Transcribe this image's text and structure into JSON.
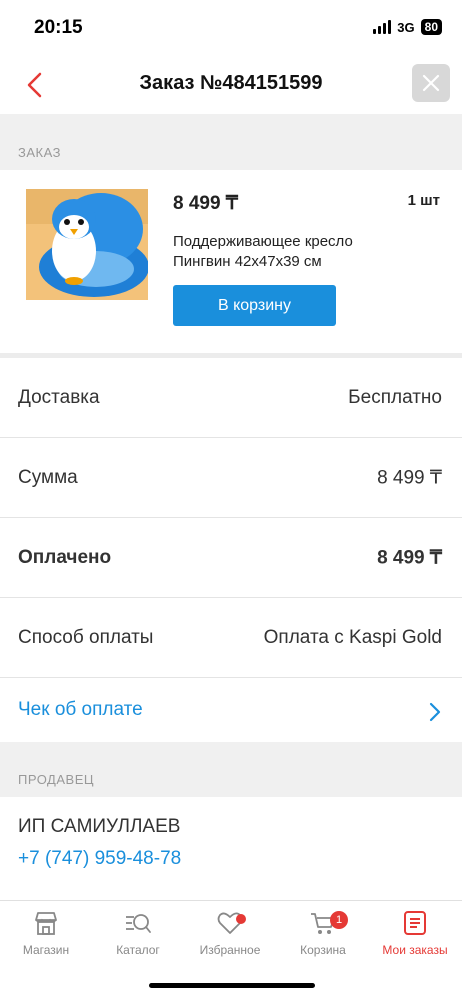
{
  "status": {
    "time": "20:15",
    "network": "3G",
    "battery": "80"
  },
  "header": {
    "title": "Заказ №484151599"
  },
  "order_section": {
    "label": "ЗАКАЗ"
  },
  "product": {
    "price": "8 499 ₸",
    "quantity": "1 шт",
    "name": "Поддерживающее кресло Пингвин 42x47x39 см",
    "cart_button": "В корзину"
  },
  "details": [
    {
      "label": "Доставка",
      "value": "Бесплатно"
    },
    {
      "label": "Сумма",
      "value": "8 499 ₸"
    },
    {
      "label": "Оплачено",
      "value": "8 499 ₸"
    },
    {
      "label": "Способ оплаты",
      "value": "Оплата с Kaspi Gold"
    }
  ],
  "receipt": {
    "label": "Чек об оплате"
  },
  "seller_section": {
    "label": "ПРОДАВЕЦ"
  },
  "seller": {
    "name": "ИП САМИУЛЛАЕВ",
    "phone": "+7 (747) 959-48-78"
  },
  "tabs": [
    {
      "label": "Магазин",
      "icon": "store-icon"
    },
    {
      "label": "Каталог",
      "icon": "catalog-search-icon"
    },
    {
      "label": "Избранное",
      "icon": "heart-icon"
    },
    {
      "label": "Корзина",
      "icon": "cart-icon",
      "badge": "1"
    },
    {
      "label": "Мои заказы",
      "icon": "orders-icon"
    }
  ],
  "colors": {
    "accent": "#1a8fdc",
    "active": "#e53935",
    "section_bg": "#f0f0f0"
  }
}
